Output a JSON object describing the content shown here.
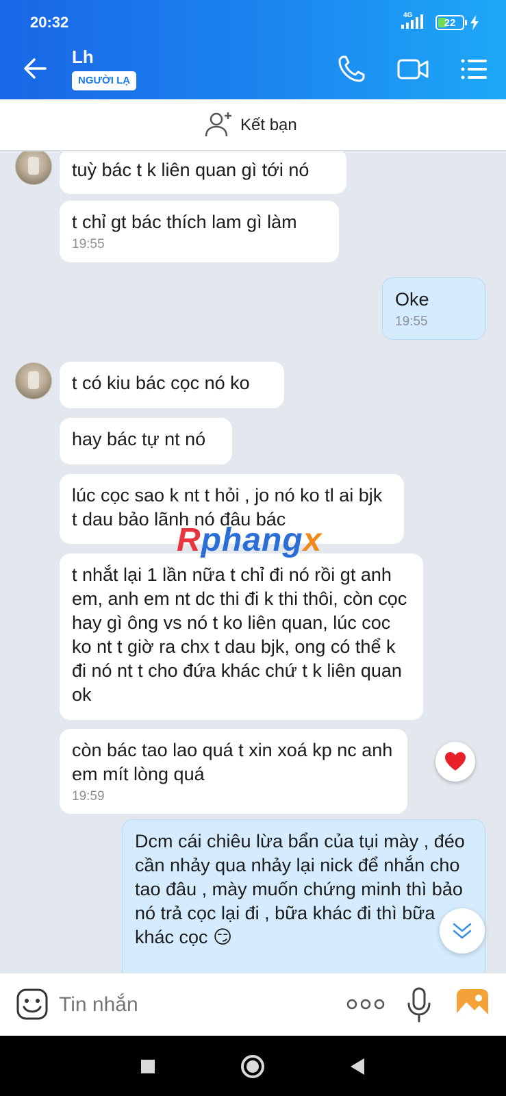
{
  "status_bar": {
    "time": "20:32",
    "network": "4G",
    "battery": "22"
  },
  "header": {
    "contact_name": "Lh",
    "badge": "NGƯỜI LẠ"
  },
  "friend_bar": {
    "label": "Kết bạn"
  },
  "messages": [
    {
      "text": "tuỳ bác t k liên quan gì tới nó",
      "time": ""
    },
    {
      "text": "t chỉ gt bác thích lam gì làm",
      "time": "19:55"
    },
    {
      "text": "Oke",
      "time": "19:55"
    },
    {
      "text": "t có kiu bác cọc nó ko",
      "time": ""
    },
    {
      "text": "hay bác tự nt nó",
      "time": ""
    },
    {
      "text": "lúc cọc sao k nt t hỏi , jo nó ko tl ai bjk t dau bảo lãnh nó đâu bác",
      "time": ""
    },
    {
      "text": "t nhắt lại 1 lần nữa t chỉ đi nó rồi gt anh em, anh em nt dc thi đi k thi thôi, còn cọc hay gì ông vs nó t ko liên quan, lúc coc ko nt t giờ ra chx t dau bjk, ong có thể k đi nó nt t cho đứa khác chứ t k liên quan ok",
      "time": ""
    },
    {
      "text": "còn bác tao lao quá t xin xoá kp nc anh em mít lòng quá",
      "time": "19:59"
    },
    {
      "text": "Dcm cái chiêu lừa bẩn của tụi mày , đéo cần nhảy qua nhảy lại nick để nhắn cho tao đâu , mày muốn chứng minh thì bảo nó trả cọc lại đi , bữa khác đi thì bữa khác cọc 😏",
      "time": ""
    }
  ],
  "watermark": {
    "part1": "R",
    "part2": "phang",
    "part3": "x"
  },
  "composer": {
    "placeholder": "Tin nhắn"
  },
  "colors": {
    "header_start": "#1a66e6",
    "header_end": "#1ea8f7",
    "outgoing_bubble": "#d4ecfd",
    "chat_bg": "#e2e8ee"
  },
  "icons": [
    "back-arrow-icon",
    "phone-icon",
    "video-call-icon",
    "list-menu-icon",
    "add-friend-icon",
    "heart-reaction-icon",
    "scroll-down-icon",
    "emoji-icon",
    "more-icon",
    "microphone-icon",
    "image-icon"
  ]
}
